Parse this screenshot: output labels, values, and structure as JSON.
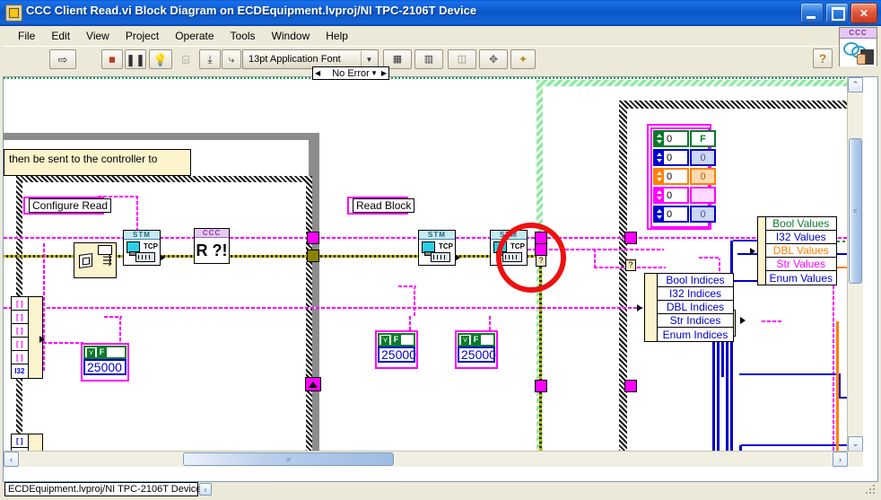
{
  "window": {
    "title": "CCC Client Read.vi Block Diagram on ECDEquipment.lvproj/NI TPC-2106T Device",
    "app_icon": "labview-vi-icon",
    "minimize_label": "",
    "maximize_label": "",
    "close_label": "✕"
  },
  "menu": {
    "items": [
      {
        "label": "File"
      },
      {
        "label": "Edit"
      },
      {
        "label": "View"
      },
      {
        "label": "Project"
      },
      {
        "label": "Operate"
      },
      {
        "label": "Tools"
      },
      {
        "label": "Window"
      },
      {
        "label": "Help"
      }
    ]
  },
  "toolbar": {
    "run_label": "⇨",
    "abort_label": "⏹",
    "pause_label": "❚❚",
    "highlight_label": "💡",
    "retain_label": "⌸",
    "stepinto_label": "⤓",
    "stepover_label": "⤷",
    "stepout_label": "⤴",
    "font_value": "13pt Application Font",
    "font_arrow": "▼",
    "align_label": "▦",
    "distribute_label": "▥",
    "resize_label": "◫",
    "reorder_label": "✥",
    "cleanup_label": "✦",
    "context_help_label": "?",
    "error_selector_value": "No Error",
    "error_left_arrow": "◀",
    "error_right_arrow": "▶",
    "error_down_arrow": "▼",
    "vi_icon_caption": "CCC"
  },
  "diagram": {
    "comment_text": "then be sent to the controller to",
    "label_configure_read": "Configure Read",
    "label_read_block": "Read Block",
    "subvi_stm_caption": "STM",
    "subvi_tcp_text": "TCP",
    "subvi_ccc_caption": "CCC",
    "subvi_ccc_text": "R ?!",
    "numeric_constants": [
      "25000",
      "25000",
      "25000"
    ],
    "cluster_index_values": [
      "0",
      "0",
      "0",
      "0",
      "0"
    ],
    "cluster_element_values": [
      "F",
      "0",
      "0",
      "",
      "0"
    ],
    "values_stack": [
      {
        "label": "Bool Values",
        "color": "#0a7a2a"
      },
      {
        "label": "I32 Values",
        "color": "#0000cc"
      },
      {
        "label": "DBL Values",
        "color": "#ff8000"
      },
      {
        "label": "Str Values",
        "color": "#ff00ff"
      },
      {
        "label": "Enum Values",
        "color": "#0000cc"
      }
    ],
    "indices_stack": [
      {
        "label": "Bool Indices",
        "color": "#0000cc"
      },
      {
        "label": "I32 Indices",
        "color": "#0000cc"
      },
      {
        "label": "DBL Indices",
        "color": "#0000cc"
      },
      {
        "label": "Str Indices",
        "color": "#0000cc"
      },
      {
        "label": "Enum Indices",
        "color": "#0000cc"
      }
    ],
    "array_terminal_top": [
      "[ ]",
      "[ ]",
      "[ ]",
      "[ ]",
      "[ ]",
      "I32"
    ],
    "array_terminal_bottom": [
      "[ ]",
      "[ ]",
      "[ ]",
      "[ ]",
      "[ ]"
    ],
    "question_tunnel_label": "?",
    "bool_indicator_label": "T",
    "highlight_marker": "red-annotation-circle"
  },
  "scroll": {
    "v_up": "⌃",
    "v_down": "⌄",
    "h_left": "‹",
    "h_right": "›",
    "thumb_grip": "≡"
  },
  "status": {
    "path_text": "ECDEquipment.lvproj/NI TPC-2106T Device",
    "path_nav_label": "‹"
  },
  "colors": {
    "title_blue": "#0a56c8",
    "chrome": "#ece9d8",
    "wire_magenta": "#ff00ff",
    "wire_yellow": "#b8ae00",
    "wire_blue": "#0000cc",
    "wire_orange": "#ff8000",
    "wire_green": "#1f8f2f",
    "highlight_red": "#ee1111",
    "loop_green": "#8fe6a0",
    "terminal_cream": "#fbf4cd"
  }
}
